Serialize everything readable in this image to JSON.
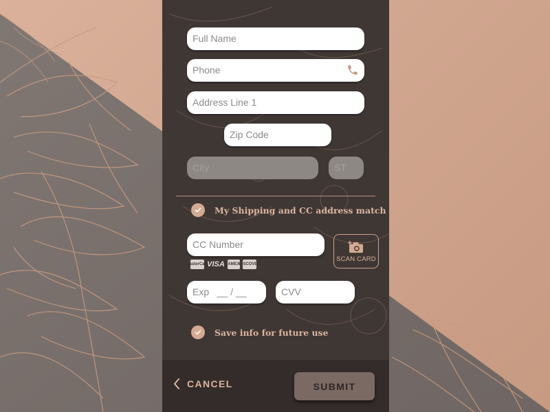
{
  "form": {
    "full_name": {
      "placeholder": "Full Name",
      "value": ""
    },
    "phone": {
      "placeholder": "Phone",
      "value": ""
    },
    "address_line_1": {
      "placeholder": "Address Line 1",
      "value": ""
    },
    "zip_code": {
      "placeholder": "Zip Code",
      "value": ""
    },
    "city": {
      "placeholder": "City",
      "value": "",
      "disabled": true
    },
    "state": {
      "placeholder": "ST",
      "value": "",
      "disabled": true
    },
    "address_match": {
      "label": "My Shipping and CC address match",
      "checked": true
    },
    "cc_number": {
      "placeholder": "CC Number",
      "value": ""
    },
    "scan_card": {
      "label": "SCAN CARD",
      "icon": "camera-plus-icon"
    },
    "card_logos": [
      "MasterCard",
      "VISA",
      "AMEX",
      "DISCOVER"
    ],
    "exp": {
      "placeholder": "Exp   __ / __",
      "value": ""
    },
    "cvv": {
      "placeholder": "CVV",
      "value": ""
    },
    "save_info": {
      "label": "Save info for future use",
      "checked": true
    }
  },
  "footer": {
    "cancel_label": "CANCEL",
    "submit_label": "SUBMIT"
  },
  "colors": {
    "accent": "#d4aa92",
    "panel": "#3f3734",
    "footer": "#332c2a",
    "submit_bg": "#7b6964",
    "background_light": "#d7ad96",
    "background_dark": "#77706d"
  }
}
